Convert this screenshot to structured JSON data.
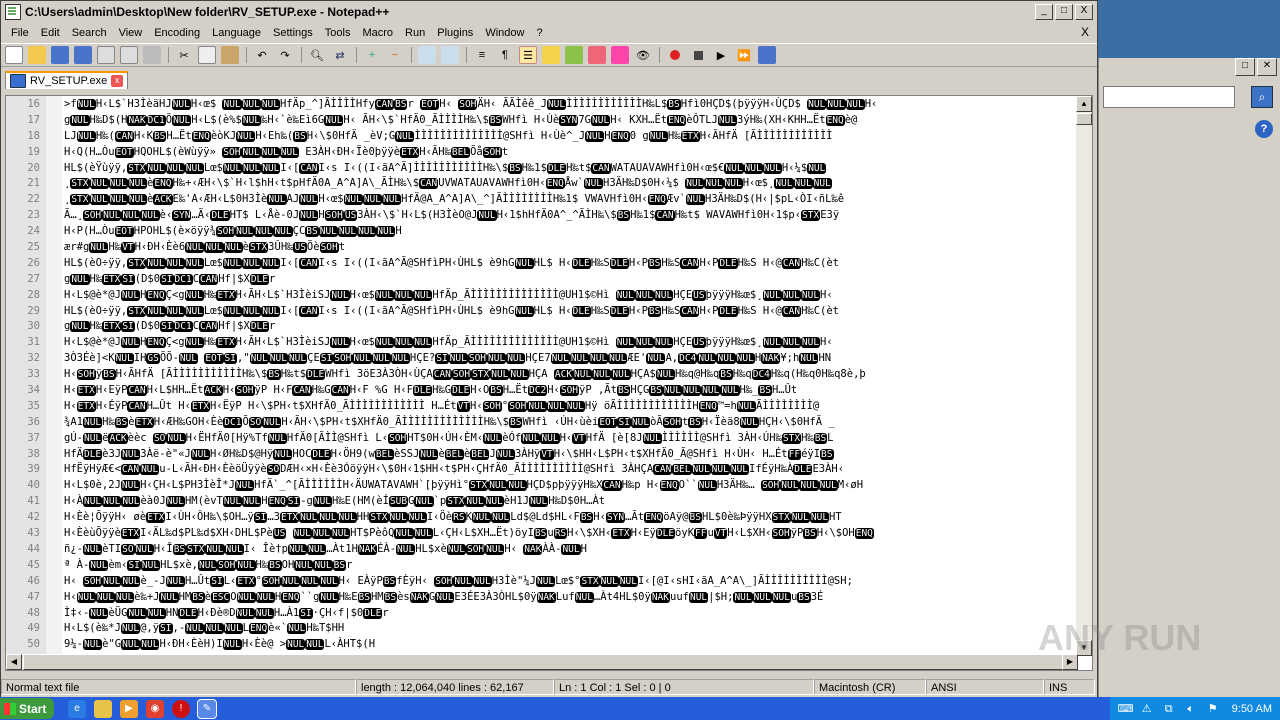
{
  "window": {
    "title": "C:\\Users\\admin\\Desktop\\New folder\\RV_SETUP.exe - Notepad++",
    "min": "_",
    "max": "□",
    "close": "X"
  },
  "menu": {
    "items": [
      "File",
      "Edit",
      "Search",
      "View",
      "Encoding",
      "Language",
      "Settings",
      "Tools",
      "Macro",
      "Run",
      "Plugins",
      "Window",
      "?"
    ],
    "close": "X"
  },
  "toolbar": {
    "icons": [
      "new-file",
      "open-file",
      "save",
      "save-all",
      "close",
      "close-all",
      "print",
      "cut",
      "copy",
      "paste",
      "undo",
      "redo",
      "find",
      "replace",
      "zoom-in",
      "zoom-out",
      "sync-v",
      "sync-h",
      "word-wrap",
      "show-all-chars",
      "indent-guide",
      "user-lang",
      "doc-map",
      "function-list",
      "folder-workspace",
      "monitor",
      "record-macro",
      "stop-macro",
      "play-macro",
      "run-macro-multiple",
      "save-macro"
    ]
  },
  "tab": {
    "label": "RV_SETUP.exe",
    "close": "x"
  },
  "editor": {
    "lines": [
      {
        "n": "16",
        "t": ">fNULH‹L$`H3ÌèäHJNULH‹œ$  NULNULNULHfÄp_^]ÃÌÌÌÌHfyCANBSr EOTH‹ SOHÄH‹ ÃÃÌêê_JNULÌÌÌÌÌÌÌÌÌÌÌÌH‰L$BSHfì0HÇD$(þÿÿÿH‹ÙÇD$ NULNULNULH‹"
      },
      {
        "n": "17",
        "t": "gNULH‰D$(HNAKDC1ÕNULH‹L$(è%$NUL‰H‹`è‰Eì6GNULH‹ ÃH‹\\$`HfÄ0_ÃÌÌÌÌH‰\\$BSWHfì H‹ÙèSYN7GNULH‹ KXH…ËtENQèÔTLJNUL3ýH‰(XH‹KHH…ËtENQè@"
      },
      {
        "n": "18",
        "t": "LJNULH‰(CANH‹KBSH…ËtENQèòKJNULH‹Eh‰(BSH‹\\$0HfÄ _èV;GNULÌÌÌÌÌÌÌÌÌÌÌÌÌÌ@SHfì H‹Ùè^_JNULHENQ0   gNULH‰ETXH‹ÃHfÄ [ÃÌÌÌÌÌÌÌÌÌÌÌÌ"
      },
      {
        "n": "19",
        "t": "H‹Q(H…ÒuEOTHQOHL$(èWùÿÿ» SOHNULNULNUL E3ÀH‹ÐH‹Ïè0þÿÿèETXH‹ÃH‰BELÕåSOHt"
      },
      {
        "n": "20",
        "t": "HL$(èŸùÿÿ,STXNULNULNULLœ$NULNULNULI‹[CANI‹s I‹((I‹ãA^Ã]ÌÌÌÌÌÌÌÌÌÌÌH‰\\$BSH‰1$DLEH‰t$CANWATAUAVAWHfì0H‹œ$€NULNULNULH‹¼$NUL"
      },
      {
        "n": "21",
        "t": "¸STXNULNULNULèENQH‰+‹ÆH‹\\$`H‹l$hH‹t$pHfÄ0A_A^A]A\\_ÃÌH‰\\$CANUVWATAUAVAWHfì0H‹ENQÅw`NULH3ÄH‰D$0H‹¼$  NULNULNULH‹œ$¸NULNULNUL"
      },
      {
        "n": "22",
        "t": "¸STXNULNULNULèACKE‰'A‹ÆH‹L$0H3ÌèNULAJNULH‹œ$NULNULNULHfÄ@A_A^A]A\\_^]ÃÌÌÌÌÌÌÌÌH‰1$ VWAVHfì0H‹ENQÆv`NULH3ÄH‰D$(H‹|$pL‹ÒI‹ñL‰ê"
      },
      {
        "n": "23",
        "t": "Ã…¸SOHNULNULNULè‹SYN…Ã‹DLEHT$ L‹Åè-0JNULHSOHUS3ÀH‹\\$`H‹L$(H3ÌèO@JNULH‹1$hHfÄ0A^_^ÃÌH‰\\$BSH‰1$CANH‰t$ WAVAWHfì0H‹1$p‹STXE3ÿ"
      },
      {
        "n": "24",
        "t": "H‹P(H…ÒuEOTHPOHL$(è×öÿÿ¾SOHNULNULNULÇCBSNULNULNULNULH"
      },
      {
        "n": "25",
        "t": "ær#gNULH‰VTH‹ÐH‹Èè6NULNULNULèSTX3ÛH‰USÕèSOHt"
      },
      {
        "n": "26",
        "t": "HL$(èO÷ÿÿ,STXNULNULNULLœ$NULNULNULI‹[CANI‹s I‹((I‹ãA^Ã@SHfìPH‹ÙHL$ è9hGNULHL$ H‹DLEH‰SDLEH‹PBSH‰SCANH‹PDLEH‰S H‹@CANH‰C(èt"
      },
      {
        "n": "27",
        "t": "gNULH‰ETXSI(D$0SIDC1CCANHf|$XDLEr"
      },
      {
        "n": "28",
        "t": "H‹L$@è*@JNULHENQÇ<gNULH‰ETXH‹ÃH‹L$`H3ÌèiSJNULH‹œ$NULNULNULHfÄp_ÃÌÌÌÌÌÌÌÌÌÌÌÌÌÌ@UH1$©Hì NULNULNULHÇEUSþÿÿÿH‰œ$¸NULNULNULH‹"
      },
      {
        "n": "29",
        "t": "HL$(èO÷ÿÿ,STXNULNULNULLœ$NULNULNULI‹[CANI‹s I‹((I‹ãA^Ã@SHfìPH‹ÙHL$ è9hGNULHL$ H‹DLEH‰SDLEH‹PBSH‰SCANH‹PDLEH‰S H‹@CANH‰C(èt"
      },
      {
        "n": "30",
        "t": "gNULH‰ETXSI(D$0SIDC1CCANHf|$XDLEr"
      },
      {
        "n": "31",
        "t": "H‹L$@è*@JNULHENQÇ<gNULH‰ETXH‹ÃH‹L$`H3ÌèiSJNULH‹œ$NULNULNULHfÄp_ÃÌÌÌÌÌÌÌÌÌÌÌÌÌÌ@UH1$©Hì NULNULNULHÇEUSþÿÿÿH‰œ$¸NULNULNULH‹"
      },
      {
        "n": "32",
        "t": "3Ò3Éè]<KNULIHGSÕÕ-NUL EOTSI,\"NULNULNULÇESISOHNULNULNULHÇE?SINULSOHNULNULHÇE7NULNULNULNULÆE'NULA,DC4NULNULNULHNAK¥;hNULHN"
      },
      {
        "n": "33",
        "t": "H‹SOHÿBSH‹ÃHfÄ [ÃÌÌÌÌÌÌÌÌÌÌÌH‰\\$BSH‰t$DLEWHfì 3öE3À3ÒH‹ÙÇACANSOHSTXNULNULHÇA ACKNULNULNULHÇA$NULH‰q@H‰qBSH‰qDC4H‰q(H‰q0H‰q8è,þ"
      },
      {
        "n": "34",
        "t": "H‹ETXH‹EÿPCANH‹L$HH…ËtACKH‹SOHÿP H‹FCANH‰GCANH‹F %G H‹FDLEH‰GDLEH‹OBSH…ËtDC2H‹SOHÿP ,ÃtBSHÇGBSNULNULNULNULH‰_BSH…Ût"
      },
      {
        "n": "35",
        "t": "H‹ETXH‹ÉÿPCANH…Ût   H‹ETXH‹ËÿP H‹\\$PH‹t$XHfÄ0_ÃÌÌÌÌÌÌÌÌÌÌÌÌ    H…ÉtVTH‹SOH°SOHNULNULNULHÿ öÃÌÌÌÌÌÌÌÌÌÌÌÌHENQ™=hNULÃÌÌÌÌÌÌÌÌ@"
      },
      {
        "n": "36",
        "t": "¾A1NULH‰BSèETXH‹ÆH‰GOH‹ÈèDC1ÕSONULH‹ÃH‹\\$PH‹t$XHfÄ0_ÃÌÌÌÌÌÌÌÌÌÌÌÌÌH‰\\$BSWHfì ‹ÚH‹ùèiEOTSINULòÃSOHtBSH‹Ïèä8NULHÇH‹\\$0HfÄ _"
      },
      {
        "n": "37",
        "t": "gÚ-NULëACKèèc SONULH‹ËHfÄ0[Hÿ%TfNULHfÄ0[ÃÌÌ@SHfì L‹SOHHT$0H‹ÚH‹ÈM‹NULèÓfNULNULH‹VTHfÄ [è[8JNULÌÌÌÌÌÌ@SHfì 3ÀH‹ÚH‰STXH‰BSL"
      },
      {
        "n": "38",
        "t": "HfÄDLEè3JNUL3Àë-è\"«JNULH‹ØH‰D$@HÿNULHOCDLEH‹ÖH9(wBELèSSJNULèBELèBELJNUL3ÀHÿVTH‹\\$HH‹L$PH‹t$XHfÄ0_Ã@SHfì H‹ÙH‹   H…ÉtFFéÿIBS"
      },
      {
        "n": "39",
        "t": "HfËÿHÿÆ€<CANNULu-L‹ÃH‹ÐH‹ÈèöÜÿÿèSODÆH‹×H‹Èè3ÓöÿÿH‹\\$0H‹1$HH‹t$PH‹ÇHfÄ0_ÃÌÌÌÌÌÌÌÌÌÌ@SHfì 3ÀHÇACANBELNULNULNULIfÉÿH‰ÀDLEE3ÀH‹"
      },
      {
        "n": "40",
        "t": "H‹L$0è,2JNULH‹ÇH‹L$PH3ÌèÎ*JNULHfÄ`_^[ÃÌÌÌÌÌÌH‹ÄUWATAVAWH`[þÿÿHì°STXNULNULHÇD$pþÿÿÿH‰XCANH‰p H‹ENQO``NULH3ÄH‰… SOHNULNULNULM‹øH"
      },
      {
        "n": "41",
        "t": "H‹ÀNULNULNULèà0JNULHM(èvTNULNULHENQSI-gNULH‰E(HM(èÍSUBGNUL`pSTXNULNULèH1JNULH‰D$0H…Àt"
      },
      {
        "n": "42",
        "t": "H‹Èè¦ÕÿÿH‹ øèETXI‹ÙH‹ÔH‰\\$OH…ÿSI…3ETXNULNULNULHHSTXNULNULI‹ÖèRSKNULNULLd$@Ld$HL‹FBSH‹SYN…ÃtENQöAÿ@BSHL$0è‰ÞÿÿHXSTXNULNULHT"
      },
      {
        "n": "43",
        "t": "H‹ÈèùÕÿÿèETXI‹ÄL‰d$PL‰d$XH‹DHL$PèUS NULNULNULHT$PèôQNULNULL‹ÇH‹L$XH…Ët)öyIBSuRSH‹\\$XH‹ETXH‹EÿDLEöyKFFuVTH‹L$XH‹SOHÿPBSH‹\\$OHENQ"
      },
      {
        "n": "44",
        "t": "ñ¿-NULèTISONULH‹ÎBSSTXNULNULI‹ Îè†pNULNUL…Àt1HNAKÉÀ-NULHL$xèNULSOHNULH‹ NAKÀÀ-NULH"
      },
      {
        "n": "45",
        "t": "ª À-NULèm‹SINULHL$xè,NULSOHNULH‰BSOHNULNULBSr"
      },
      {
        "n": "46",
        "t": "H‹  SOHNULNULè_-JNULH…ÛtSIL‹ETX°SOHNULNULNULH‹ EÀÿPBSfÈÿH‹  SOHNULNULH3Ìè\"¼JNULLœ$°STXNULNULI‹[@I‹sHI‹ãA_A^A\\_]ÃÌÌÌÌÌÌÌÌÌÌ@SH;"
      },
      {
        "n": "47",
        "t": "H‹NULNULNULè‰+JNULHMBSèESCONULNULHENQ``gNULH‰EBSHMBSèsNAKGNULE3ÉE3À3ÒHL$0ÿNAKLufNUL…Àt4HL$0ÿNAKuufNUL|$H;NULNULNULuBS3É"
      },
      {
        "n": "48",
        "t": "Ì‡‹-NULèÜGNULNULHNDLEH‹Ðè®DNULNULH…À1SI·ÇH‹f|$0DLEr"
      },
      {
        "n": "49",
        "t": "H‹L$(è‰*JNUL@,ÿSI,-NULNULNULLENQè«`NULH‰T$HH"
      },
      {
        "n": "50",
        "t": "9¼-NULè\"GNULNULH‹ÐH‹ÈèH)INULH‹Èè@ >NULNULL‹ÀHT$(H"
      }
    ]
  },
  "status": {
    "type": "Normal text file",
    "length": "length : 12,064,040   lines : 62,167",
    "pos": "Ln : 1    Col : 1    Sel : 0 | 0",
    "eol": "Macintosh (CR)",
    "encoding": "ANSI",
    "mode": "INS"
  },
  "taskbar": {
    "start": "Start",
    "clock": "9:50 AM"
  },
  "watermark": "ANY RUN"
}
